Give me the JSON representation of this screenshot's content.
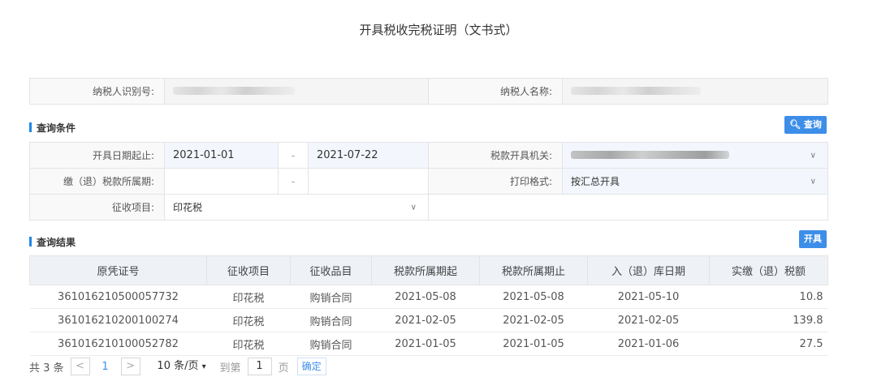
{
  "title": "开具税收完税证明（文书式）",
  "taxpayer": {
    "id_label": "纳税人识别号:",
    "name_label": "纳税人名称:"
  },
  "query": {
    "section_title": "查询条件",
    "search_button": "查询",
    "date_label": "开具日期起止:",
    "date_from": "2021-01-01",
    "date_sep": "-",
    "date_to": "2021-07-22",
    "office_label": "税款开具机关:",
    "period_label": "缴（退）税款所属期:",
    "period_sep": "-",
    "print_label": "打印格式:",
    "print_value": "按汇总开具",
    "item_label": "征收项目:",
    "item_value": "印花税"
  },
  "results": {
    "section_title": "查询结果",
    "issue_button": "开具",
    "columns": [
      "原凭证号",
      "征收项目",
      "征收品目",
      "税款所属期起",
      "税款所属期止",
      "入（退）库日期",
      "实缴（退）税额"
    ],
    "rows": [
      [
        "361016210500057732",
        "印花税",
        "购销合同",
        "2021-05-08",
        "2021-05-08",
        "2021-05-10",
        "10.8"
      ],
      [
        "361016210200100274",
        "印花税",
        "购销合同",
        "2021-02-05",
        "2021-02-05",
        "2021-02-05",
        "139.8"
      ],
      [
        "361016210100052782",
        "印花税",
        "购销合同",
        "2021-01-05",
        "2021-01-05",
        "2021-01-06",
        "27.5"
      ]
    ]
  },
  "pager": {
    "total": "共 3 条",
    "prev": "<",
    "page": "1",
    "next": ">",
    "page_size": "10 条/页",
    "goto": "到第",
    "goto_value": "1",
    "page_unit": "页",
    "confirm": "确定"
  },
  "icons": {
    "search": "search-icon",
    "dropdown": "chevron-down-icon"
  },
  "colors": {
    "accent": "#3d8ee8",
    "section_bar": "#1e88e5",
    "input_bg": "#f3f7fd"
  }
}
